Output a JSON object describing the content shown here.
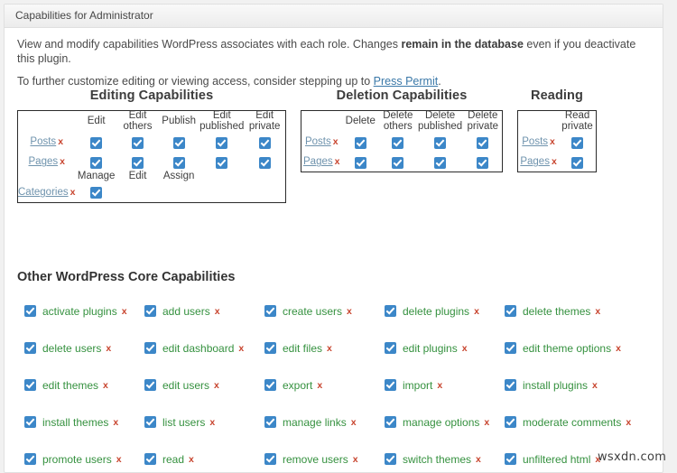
{
  "panel": {
    "title": "Capabilities for Administrator"
  },
  "intro": {
    "line1_a": "View and modify capabilities WordPress associates with each role. Changes ",
    "line1_b": "remain in the database",
    "line1_c": " even if you deactivate this plugin.",
    "line2_a": "To further customize editing or viewing access, consider stepping up to ",
    "line2_link": "Press Permit",
    "line2_c": "."
  },
  "x_label": "x",
  "groups": [
    {
      "title": "Editing Capabilities",
      "columns": [
        "Edit",
        "Edit others",
        "Publish",
        "Edit published",
        "Edit private"
      ],
      "rows": [
        {
          "label": "Posts",
          "checks": [
            true,
            true,
            true,
            true,
            true
          ]
        },
        {
          "label": "Pages",
          "checks": [
            true,
            true,
            true,
            true,
            true
          ]
        }
      ],
      "sub": {
        "columns": [
          "Manage",
          "Edit",
          "Assign"
        ],
        "rows": [
          {
            "label": "Categories",
            "checks": [
              true,
              false,
              false
            ]
          }
        ]
      }
    },
    {
      "title": "Deletion Capabilities",
      "columns": [
        "Delete",
        "Delete others",
        "Delete published",
        "Delete private"
      ],
      "rows": [
        {
          "label": "Posts",
          "checks": [
            true,
            true,
            true,
            true
          ]
        },
        {
          "label": "Pages",
          "checks": [
            true,
            true,
            true,
            true
          ]
        }
      ]
    },
    {
      "title": "Reading",
      "columns": [
        "Read private"
      ],
      "rows": [
        {
          "label": "Posts",
          "checks": [
            true
          ]
        },
        {
          "label": "Pages",
          "checks": [
            true
          ]
        }
      ]
    }
  ],
  "other": {
    "heading": "Other WordPress Core Capabilities",
    "items": [
      {
        "name": "activate plugins",
        "checked": true
      },
      {
        "name": "add users",
        "checked": true
      },
      {
        "name": "create users",
        "checked": true
      },
      {
        "name": "delete plugins",
        "checked": true
      },
      {
        "name": "delete themes",
        "checked": true
      },
      {
        "name": "delete users",
        "checked": true
      },
      {
        "name": "edit dashboard",
        "checked": true
      },
      {
        "name": "edit files",
        "checked": true
      },
      {
        "name": "edit plugins",
        "checked": true
      },
      {
        "name": "edit theme options",
        "checked": true
      },
      {
        "name": "edit themes",
        "checked": true
      },
      {
        "name": "edit users",
        "checked": true
      },
      {
        "name": "export",
        "checked": true
      },
      {
        "name": "import",
        "checked": true
      },
      {
        "name": "install plugins",
        "checked": true
      },
      {
        "name": "install themes",
        "checked": true
      },
      {
        "name": "list users",
        "checked": true
      },
      {
        "name": "manage links",
        "checked": true
      },
      {
        "name": "manage options",
        "checked": true
      },
      {
        "name": "moderate comments",
        "checked": true
      },
      {
        "name": "promote users",
        "checked": true
      },
      {
        "name": "read",
        "checked": true
      },
      {
        "name": "remove users",
        "checked": true
      },
      {
        "name": "switch themes",
        "checked": true
      },
      {
        "name": "unfiltered html",
        "checked": true
      }
    ]
  },
  "watermark": "wsxdn.com",
  "colors": {
    "checkbox": "#3c87c8",
    "cap_link": "#35913f",
    "row_link": "#6f93ad",
    "x_mark": "#c8452f",
    "intro_link": "#3a78a8"
  }
}
